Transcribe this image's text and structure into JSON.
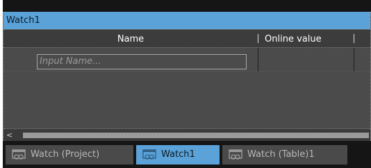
{
  "window": {
    "title": "Watch1"
  },
  "table": {
    "columns": [
      "Name",
      "Online value"
    ],
    "input_placeholder": "Input Name..."
  },
  "scrollbar": {
    "left_arrow": "<"
  },
  "tabs": [
    {
      "label": "Watch (Project)",
      "active": false
    },
    {
      "label": "Watch1",
      "active": true
    },
    {
      "label": "Watch (Table)1",
      "active": false
    }
  ],
  "colors": {
    "accent": "#5aa2d8",
    "panel_background": "#4a4a4a",
    "outer_background": "#151515"
  },
  "icons": {
    "tab": "watch-window-icon"
  }
}
